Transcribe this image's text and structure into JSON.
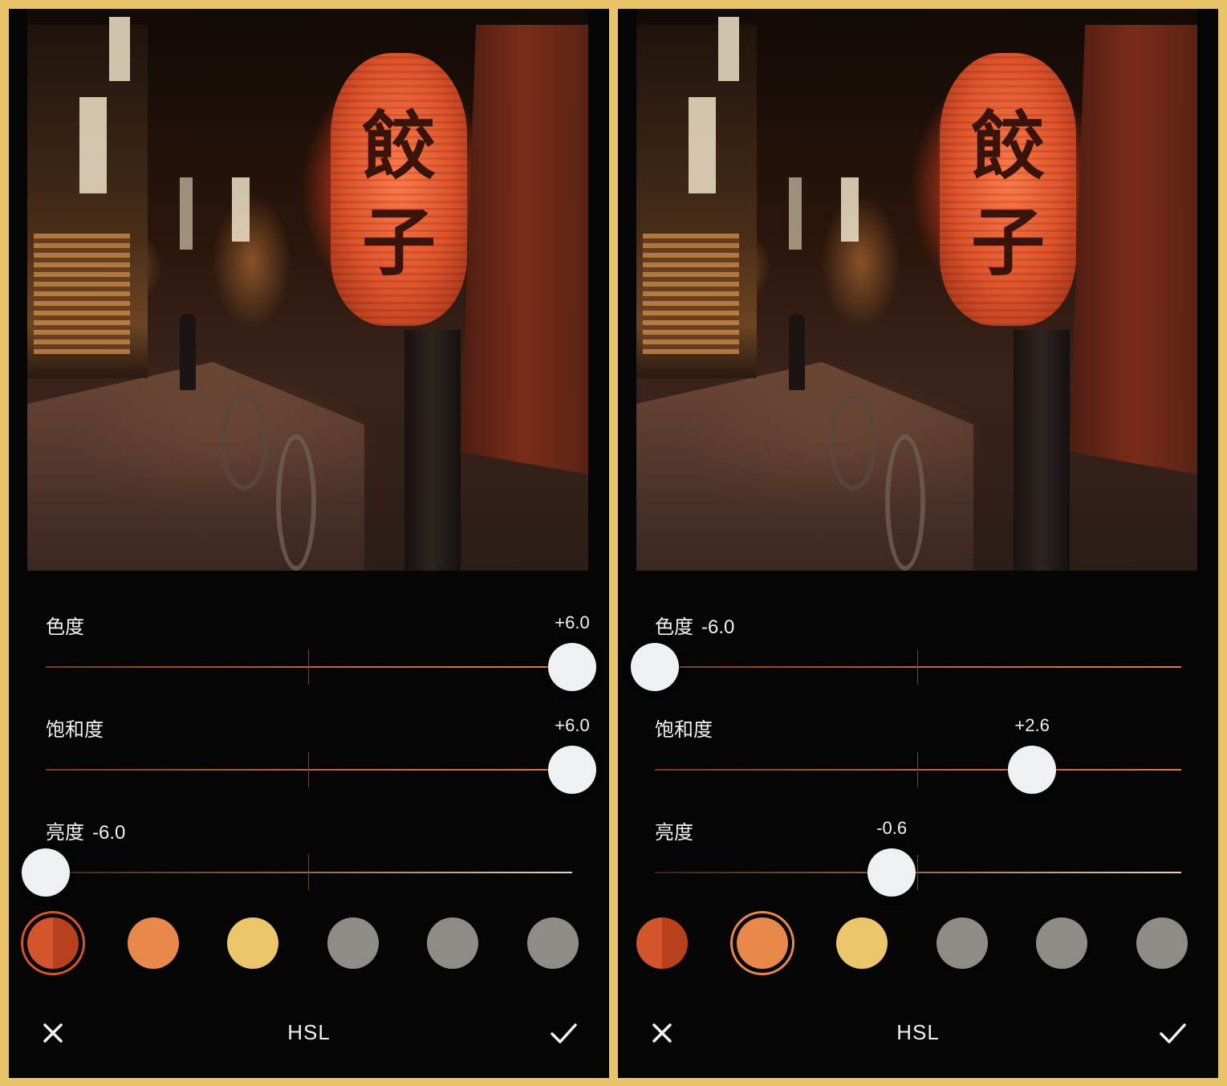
{
  "panels": [
    {
      "sliders": [
        {
          "label": "色度",
          "value": "+6.0",
          "position": 1.0
        },
        {
          "label": "饱和度",
          "value": "+6.0",
          "position": 1.0
        },
        {
          "label": "亮度",
          "value": "-6.0",
          "position": 0.0
        }
      ],
      "selected_swatch": 0,
      "title": "HSL"
    },
    {
      "sliders": [
        {
          "label": "色度",
          "value": "-6.0",
          "position": 0.0
        },
        {
          "label": "饱和度",
          "value": "+2.6",
          "position": 0.7167
        },
        {
          "label": "亮度",
          "value": "-0.6",
          "position": 0.45
        }
      ],
      "selected_swatch": 1,
      "title": "HSL"
    }
  ],
  "swatches": [
    {
      "name": "red",
      "color": "#d4552b",
      "color2": "#b8401d",
      "ring": "#d4552b"
    },
    {
      "name": "orange",
      "color": "#e8884a",
      "color2": "#e8884a",
      "ring": "#e8884a"
    },
    {
      "name": "yellow",
      "color": "#ecc66b",
      "color2": "#ecc66b",
      "ring": "#ecc66b"
    },
    {
      "name": "gray-1",
      "color": "#8f8c88",
      "color2": "#8f8c88",
      "ring": "#8f8c88"
    },
    {
      "name": "gray-2",
      "color": "#8f8c88",
      "color2": "#8f8c88",
      "ring": "#8f8c88"
    },
    {
      "name": "gray-3",
      "color": "#8f8c88",
      "color2": "#8f8c88",
      "ring": "#8f8c88"
    }
  ],
  "photo": {
    "lantern_text": [
      "餃",
      "子"
    ]
  },
  "colors": {
    "frame": "#e9c46a",
    "background": "#050505",
    "thumb": "#eef1f2",
    "track_hue": "#c0623a",
    "track_sat": "#c0623a",
    "track_light": "#8a6a4a"
  },
  "icons": {
    "close": "close-icon",
    "confirm": "check-icon"
  }
}
